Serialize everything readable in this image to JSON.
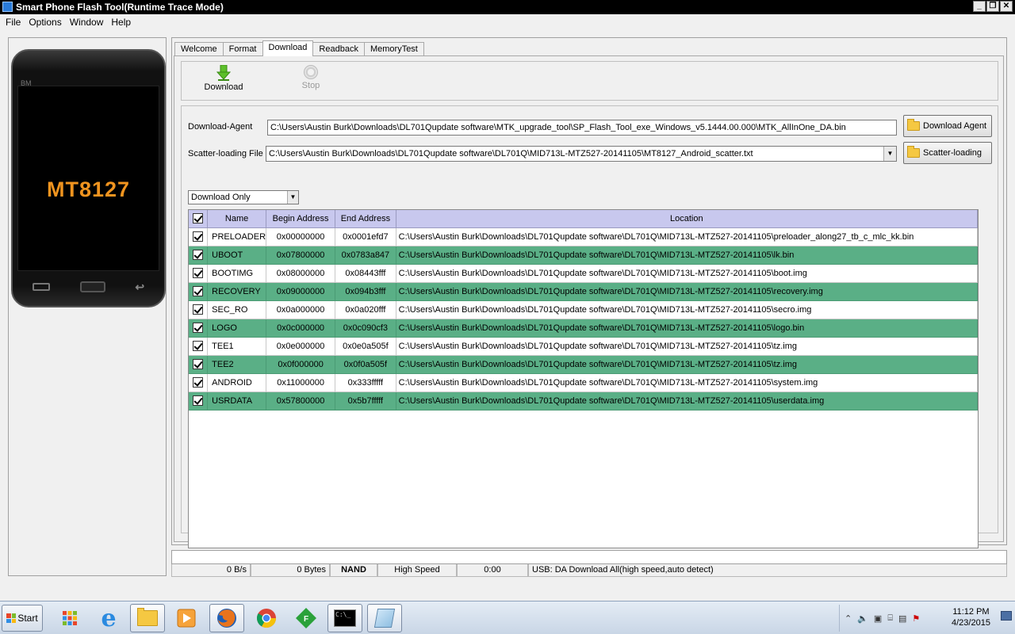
{
  "window": {
    "title": "Smart Phone Flash Tool(Runtime Trace Mode)",
    "controls": [
      "minimize",
      "restore",
      "close"
    ]
  },
  "menu": [
    {
      "label": "File",
      "accel": "F"
    },
    {
      "label": "Options",
      "accel": "O"
    },
    {
      "label": "Window",
      "accel": "W"
    },
    {
      "label": "Help",
      "accel": "H"
    }
  ],
  "phone": {
    "brand": "BM",
    "chip": "MT8127"
  },
  "tabs": [
    {
      "label": "Welcome",
      "active": false
    },
    {
      "label": "Format",
      "active": false
    },
    {
      "label": "Download",
      "active": true
    },
    {
      "label": "Readback",
      "active": false
    },
    {
      "label": "MemoryTest",
      "active": false
    }
  ],
  "toolbar": {
    "download_label": "Download",
    "stop_label": "Stop",
    "icons": {
      "download": "green-down-arrow-icon",
      "stop": "stop-circle-icon"
    }
  },
  "download_agent": {
    "label": "Download-Agent",
    "value": "C:\\Users\\Austin Burk\\Downloads\\DL701Qupdate software\\MTK_upgrade_tool\\SP_Flash_Tool_exe_Windows_v5.1444.00.000\\MTK_AllInOne_DA.bin",
    "button": "Download Agent"
  },
  "scatter": {
    "label": "Scatter-loading File",
    "value": "C:\\Users\\Austin Burk\\Downloads\\DL701Qupdate software\\DL701Q\\MID713L-MTZ527-20141105\\MT8127_Android_scatter.txt",
    "button": "Scatter-loading"
  },
  "mode": {
    "selected": "Download Only"
  },
  "table": {
    "headers": [
      "",
      "Name",
      "Begin Address",
      "End Address",
      "Location"
    ],
    "header_checked": true,
    "rows": [
      {
        "checked": true,
        "name": "PRELOADER",
        "begin": "0x00000000",
        "end": "0x0001efd7",
        "location": "C:\\Users\\Austin Burk\\Downloads\\DL701Qupdate software\\DL701Q\\MID713L-MTZ527-20141105\\preloader_along27_tb_c_mlc_kk.bin"
      },
      {
        "checked": true,
        "name": "UBOOT",
        "begin": "0x07800000",
        "end": "0x0783a847",
        "location": "C:\\Users\\Austin Burk\\Downloads\\DL701Qupdate software\\DL701Q\\MID713L-MTZ527-20141105\\lk.bin"
      },
      {
        "checked": true,
        "name": "BOOTIMG",
        "begin": "0x08000000",
        "end": "0x08443fff",
        "location": "C:\\Users\\Austin Burk\\Downloads\\DL701Qupdate software\\DL701Q\\MID713L-MTZ527-20141105\\boot.img"
      },
      {
        "checked": true,
        "name": "RECOVERY",
        "begin": "0x09000000",
        "end": "0x094b3fff",
        "location": "C:\\Users\\Austin Burk\\Downloads\\DL701Qupdate software\\DL701Q\\MID713L-MTZ527-20141105\\recovery.img"
      },
      {
        "checked": true,
        "name": "SEC_RO",
        "begin": "0x0a000000",
        "end": "0x0a020fff",
        "location": "C:\\Users\\Austin Burk\\Downloads\\DL701Qupdate software\\DL701Q\\MID713L-MTZ527-20141105\\secro.img"
      },
      {
        "checked": true,
        "name": "LOGO",
        "begin": "0x0c000000",
        "end": "0x0c090cf3",
        "location": "C:\\Users\\Austin Burk\\Downloads\\DL701Qupdate software\\DL701Q\\MID713L-MTZ527-20141105\\logo.bin"
      },
      {
        "checked": true,
        "name": "TEE1",
        "begin": "0x0e000000",
        "end": "0x0e0a505f",
        "location": "C:\\Users\\Austin Burk\\Downloads\\DL701Qupdate software\\DL701Q\\MID713L-MTZ527-20141105\\tz.img"
      },
      {
        "checked": true,
        "name": "TEE2",
        "begin": "0x0f000000",
        "end": "0x0f0a505f",
        "location": "C:\\Users\\Austin Burk\\Downloads\\DL701Qupdate software\\DL701Q\\MID713L-MTZ527-20141105\\tz.img"
      },
      {
        "checked": true,
        "name": "ANDROID",
        "begin": "0x11000000",
        "end": "0x333fffff",
        "location": "C:\\Users\\Austin Burk\\Downloads\\DL701Qupdate software\\DL701Q\\MID713L-MTZ527-20141105\\system.img"
      },
      {
        "checked": true,
        "name": "USRDATA",
        "begin": "0x57800000",
        "end": "0x5b7fffff",
        "location": "C:\\Users\\Austin Burk\\Downloads\\DL701Qupdate software\\DL701Q\\MID713L-MTZ527-20141105\\userdata.img"
      }
    ]
  },
  "colors": {
    "alt_row": "#5aaf86",
    "header": "#c8c8ee",
    "chip_text": "#f0941f"
  },
  "progress": {
    "percent": 0
  },
  "status": {
    "speed": "0 B/s",
    "bytes": "0 Bytes",
    "storage": "NAND",
    "mode": "High Speed",
    "time": "0:00",
    "usb": "USB: DA Download All(high speed,auto detect)"
  },
  "taskbar": {
    "start_label": "Start",
    "apps": [
      "apps-grid",
      "internet-explorer",
      "file-explorer",
      "media-player",
      "firefox",
      "chrome",
      "f-app",
      "command-prompt",
      "notepad"
    ],
    "active_app": "firefox",
    "clock_time": "11:12 PM",
    "clock_date": "4/23/2015"
  }
}
